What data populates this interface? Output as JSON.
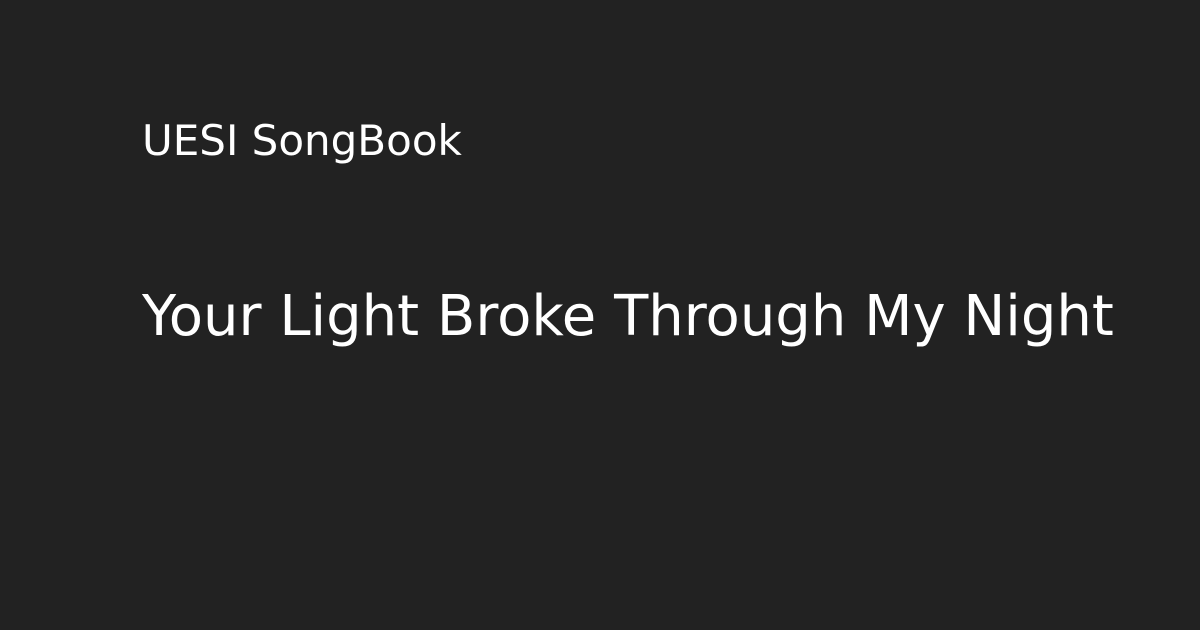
{
  "site": {
    "name": "UESI SongBook"
  },
  "song": {
    "title": "Your Light Broke Through My Night"
  },
  "colors": {
    "background": "#222222",
    "text": "#ffffff"
  }
}
